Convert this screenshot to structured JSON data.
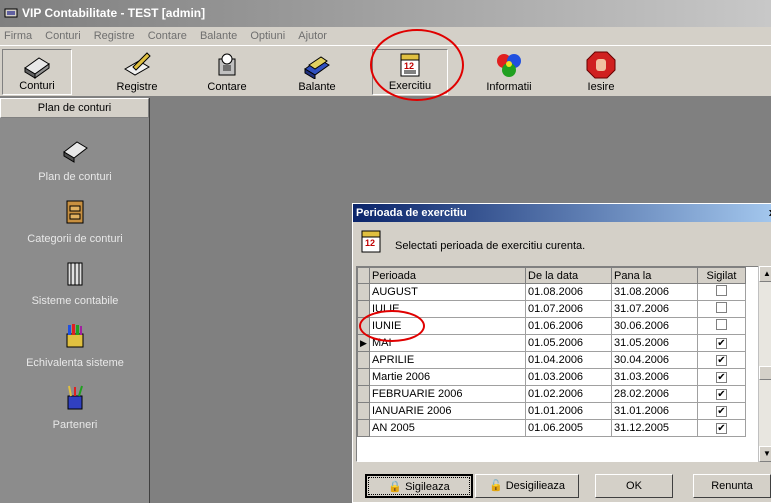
{
  "window": {
    "title": "VIP Contabilitate - TEST [admin]"
  },
  "menu": [
    "Firma",
    "Conturi",
    "Registre",
    "Contare",
    "Balante",
    "Optiuni",
    "Ajutor"
  ],
  "toolbar": {
    "conturi": "Conturi",
    "registre": "Registre",
    "contare": "Contare",
    "balante": "Balante",
    "exercitiu": "Exercitiu",
    "informatii": "Informatii",
    "iesire": "Iesire"
  },
  "sidebar": {
    "header": "Plan de conturi",
    "items": [
      {
        "label": "Plan de conturi",
        "icon": "books-icon"
      },
      {
        "label": "Categorii de conturi",
        "icon": "cabinet-icon"
      },
      {
        "label": "Sisteme contabile",
        "icon": "binder-icon"
      },
      {
        "label": "Echivalenta sisteme",
        "icon": "crayons-icon"
      },
      {
        "label": "Parteneri",
        "icon": "mug-icon"
      }
    ]
  },
  "dialog": {
    "title": "Perioada de exercitiu",
    "close": "x",
    "message": "Selectati perioada de exercitiu curenta.",
    "columns": [
      "Perioada",
      "De la data",
      "Pana la",
      "Sigilat"
    ],
    "rows": [
      {
        "perioada": "AUGUST",
        "de": "01.08.2006",
        "pana": "31.08.2006",
        "sigilat": false
      },
      {
        "perioada": "IULIE",
        "de": "01.07.2006",
        "pana": "31.07.2006",
        "sigilat": false
      },
      {
        "perioada": "IUNIE",
        "de": "01.06.2006",
        "pana": "30.06.2006",
        "sigilat": false
      },
      {
        "perioada": "MAI",
        "de": "01.05.2006",
        "pana": "31.05.2006",
        "sigilat": true,
        "current": true
      },
      {
        "perioada": "APRILIE",
        "de": "01.04.2006",
        "pana": "30.04.2006",
        "sigilat": true
      },
      {
        "perioada": "Martie 2006",
        "de": "01.03.2006",
        "pana": "31.03.2006",
        "sigilat": true
      },
      {
        "perioada": "FEBRUARIE 2006",
        "de": "01.02.2006",
        "pana": "28.02.2006",
        "sigilat": true
      },
      {
        "perioada": "IANUARIE 2006",
        "de": "01.01.2006",
        "pana": "31.01.2006",
        "sigilat": true
      },
      {
        "perioada": "AN 2005",
        "de": "01.06.2005",
        "pana": "31.12.2005",
        "sigilat": true
      }
    ],
    "buttons": {
      "sigileaza": "Sigileaza",
      "desigileaza": "Desigilieaza",
      "ok": "OK",
      "renunta": "Renunta"
    }
  },
  "colors": {
    "desktop": "#808080",
    "sidebar": "#8c8c8c",
    "face": "#d4d0c8",
    "annotation": "#e00000",
    "dialog_title": "#0a246a"
  }
}
